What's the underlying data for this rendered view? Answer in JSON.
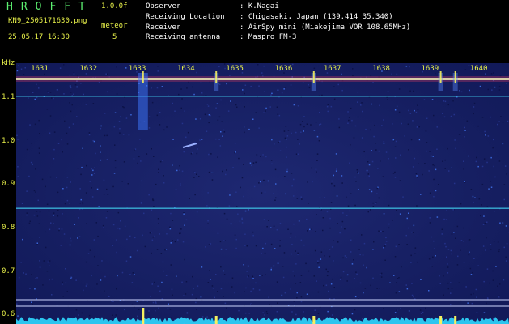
{
  "header": {
    "app_title": "HROFFT",
    "app_version": "1.0.0f",
    "filename": "KN9_2505171630.png",
    "mode": "meteor",
    "datetime": "25.05.17 16:30",
    "count": "5",
    "info": [
      {
        "label": "Observer",
        "value": ": K.Nagai"
      },
      {
        "label": "Receiving Location",
        "value": ": Chigasaki, Japan (139.414 35.340)"
      },
      {
        "label": "Receiver",
        "value": ": AirSpy mini (Miakejima VOR 108.65MHz)"
      },
      {
        "label": "Receiving antenna",
        "value": ": Maspro FM-3"
      }
    ]
  },
  "colors": {
    "background": "#000000",
    "plot_bg": "#161f62",
    "text_yellow": "#e9f24a",
    "title_green": "#5cf070",
    "trace_cyan": "#2fd8ff",
    "echo_yellow": "#f4f060"
  },
  "chart_data": {
    "type": "heatmap",
    "y_unit_label": "kHz",
    "x_ticks": [
      "1631",
      "1632",
      "1633",
      "1634",
      "1635",
      "1636",
      "1637",
      "1638",
      "1639",
      "1640"
    ],
    "y_ticks": [
      "1.1",
      "1.0",
      "0.9",
      "0.8",
      "0.7",
      "0.6"
    ],
    "y_range": [
      0.58,
      1.18
    ],
    "horizontal_signals_khz": [
      1.104,
      0.846
    ],
    "meteor_echoes": [
      {
        "x_minute": 1633.1,
        "strength": "strong"
      },
      {
        "x_minute": 1634.6,
        "strength": "weak"
      },
      {
        "x_minute": 1636.6,
        "strength": "weak"
      },
      {
        "x_minute": 1639.2,
        "strength": "weak"
      },
      {
        "x_minute": 1639.5,
        "strength": "weak"
      }
    ]
  }
}
